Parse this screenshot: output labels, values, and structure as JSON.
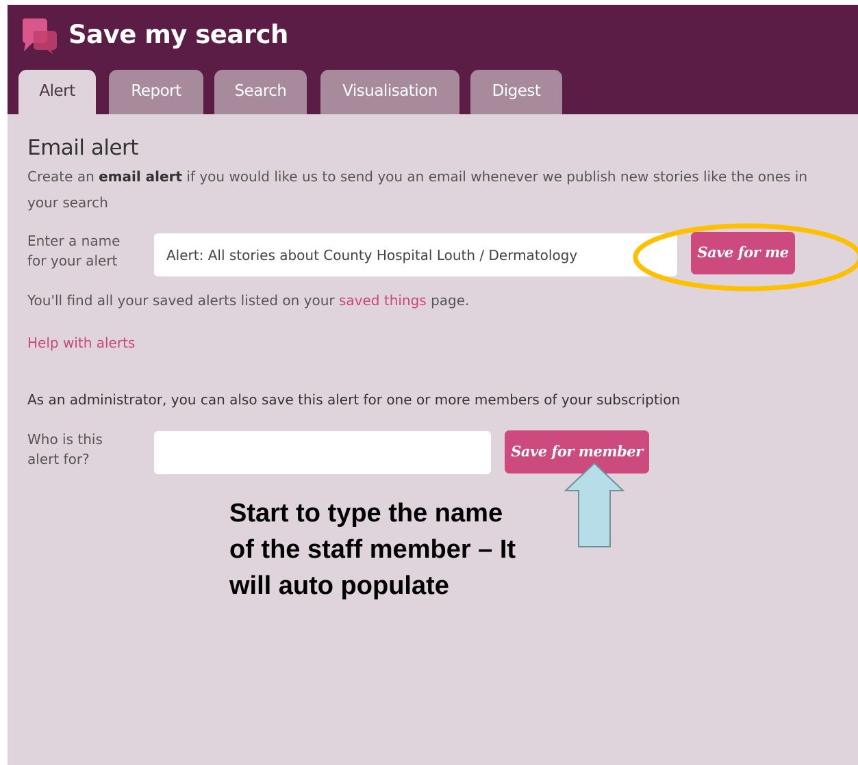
{
  "header": {
    "title": "Save my search",
    "logo_icon": "speech-bubbles-logo-icon"
  },
  "tabs": [
    {
      "label": "Alert",
      "active": true
    },
    {
      "label": "Report",
      "active": false
    },
    {
      "label": "Search",
      "active": false
    },
    {
      "label": "Visualisation",
      "active": false
    },
    {
      "label": "Digest",
      "active": false
    }
  ],
  "email_alert": {
    "heading": "Email alert",
    "description_pre": "Create an ",
    "description_bold": "email alert",
    "description_post": " if you would like us to send you an email whenever we publish new stories like the ones in your search",
    "name_label_line1": "Enter a name",
    "name_label_line2": "for your alert",
    "name_value": "Alert: All stories about County Hospital Louth / Dermatology",
    "save_for_me_label": "Save for me",
    "info_pre": "You'll find all your saved alerts listed on your ",
    "info_link": "saved things",
    "info_post": " page.",
    "help_link": "Help with alerts"
  },
  "admin": {
    "text": "As an administrator, you can also save this alert for one or more members of your subscription",
    "who_label_line1": "Who is this",
    "who_label_line2": "alert for?",
    "member_value": "",
    "save_for_member_label": "Save for member"
  },
  "annotation": {
    "callout_text": "Start to type the name of the staff member – It will auto populate",
    "ellipse_color": "#ffc000",
    "arrow_fill": "#b7dee8",
    "arrow_stroke": "#6f8f96"
  },
  "colors": {
    "header_bg": "#5b1c45",
    "panel_bg": "#e0d4dc",
    "tab_inactive_bg": "#a78b9c",
    "button_bg": "#cc4a7d",
    "link": "#c9467a"
  }
}
